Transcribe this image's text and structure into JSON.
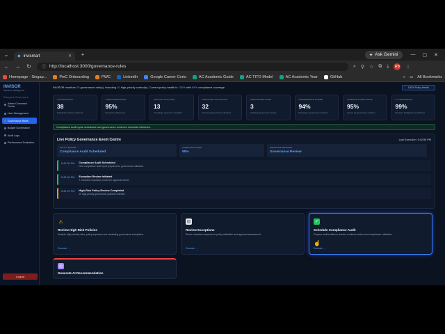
{
  "browser": {
    "tab_title": "invismart",
    "gemini_label": "Ask Gemini",
    "url": "http://localhost:3000/governance-rules",
    "profile_initials": "RB",
    "bookmarks": [
      {
        "label": "Homepage - Singap...",
        "color": "#e74c3c"
      },
      {
        "label": "PwC Onboarding",
        "color": "#e67e22"
      },
      {
        "label": "PWC",
        "color": "#e67e22"
      },
      {
        "label": "LinkedIn",
        "color": "#0a66c2"
      },
      {
        "label": "Google Career Certs",
        "color": "#4285f4"
      },
      {
        "label": "AC Academic Guide",
        "color": "#16a085"
      },
      {
        "label": "AC TITO Model",
        "color": "#16a085"
      },
      {
        "label": "AC Academic Year",
        "color": "#16a085"
      },
      {
        "label": "GitHub",
        "color": "#ffffff"
      }
    ],
    "all_bookmarks": "All Bookmarks"
  },
  "sidebar": {
    "brand": "INVISOR",
    "brand_sub": "System Intelligence",
    "section": "Enterprise Governance",
    "items": [
      {
        "label": "Admin Command Center"
      },
      {
        "label": "User Management"
      },
      {
        "label": "Governance Rules"
      },
      {
        "label": "Budget Governance"
      },
      {
        "label": "Audit Logs"
      },
      {
        "label": "Performance Evaluation"
      }
    ],
    "logout": "Logout"
  },
  "summary": {
    "prefix": "INVISOR monitors",
    "rules": "25",
    "middle": "governance rule(s), including",
    "high": "10",
    "middle2": "high-priority control(s). Current policy health is",
    "health": "100%",
    "middle3": "with",
    "compliance": "95%",
    "suffix": "compliance coverage.",
    "button": "100% Policy Health"
  },
  "kpis": [
    {
      "label": "ACTIVE RULES",
      "value": "38",
      "sub": "Enterprise policies enforced"
    },
    {
      "label": "COMPLIANCE RATE",
      "value": "95%",
      "sub": "Enterprise adherence"
    },
    {
      "label": "CRITICAL POLICIES",
      "value": "13",
      "sub": "Immediate executive oversight"
    },
    {
      "label": "DETECTED VIOLATIONS",
      "value": "32",
      "sub": "Across all governance domains"
    },
    {
      "label": "OPEN EXCEPTIONS",
      "value": "3",
      "sub": "Awaiting governance review"
    },
    {
      "label": "GOVERNANCE SCORE",
      "value": "94%",
      "sub": "Enterprise governance maturity"
    },
    {
      "label": "AVERAGE COMPLIANCE",
      "value": "95%",
      "sub": "Across all governance policies"
    },
    {
      "label": "AI CONFIDENCE",
      "value": "99%",
      "sub": "Decision intelligence confidence"
    }
  ],
  "banner": "Compliance audit cycle scheduled and governance evidence checklist refreshed.",
  "event_centre": {
    "title": "Live Policy Governance Event Centre",
    "last_execution": "Last Execution: 5:42:55 PM",
    "meta": [
      {
        "label": "POLICY ENGINE",
        "value": "Compliance Audit Scheduled"
      },
      {
        "label": "COMPLIANCE RATE",
        "value": "95%"
      },
      {
        "label": "EXECUTIVE DECISION",
        "value": "Governance Review"
      }
    ],
    "logs": [
      {
        "time": "5:42:55 PM",
        "title": "Compliance Audit Scheduled",
        "desc": "Next compliance audit cycle prepared for governance validation."
      },
      {
        "time": "5:42:34 PM",
        "title": "Exception Review Initiated",
        "desc": "7 exception request(s) routed for approval review."
      },
      {
        "time": "5:42:15 PM",
        "title": "High-Risk Policy Review Completed",
        "desc": "10 high-priority governance policies reviewed."
      }
    ]
  },
  "actions": [
    {
      "icon": "⚠",
      "title": "Review High Risk Policies",
      "desc": "Analyze high-priority rules, policy exposure and escalating governance exceptions.",
      "execute": "Execute →"
    },
    {
      "icon": "▤",
      "title": "Review Exceptions",
      "desc": "Route exception requests for policy validation and approval assessment.",
      "execute": "Execute →"
    },
    {
      "icon": "✓",
      "title": "Schedule Compliance Audit",
      "desc": "Prepare audit evidence checks, evidence review and compliance validation.",
      "execute": "Execute →"
    }
  ],
  "ai_card": {
    "icon": "◎",
    "title": "Generate AI Recommendation"
  }
}
